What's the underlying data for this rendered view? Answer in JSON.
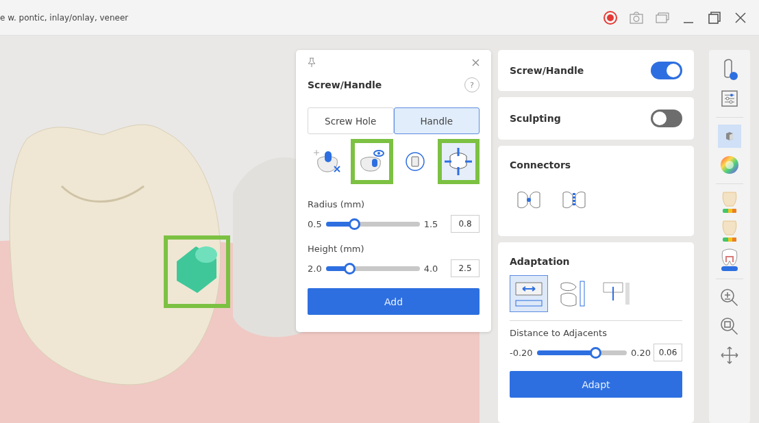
{
  "window": {
    "title": "e w. pontic, inlay/onlay, veneer",
    "recording": true
  },
  "model": {
    "handle_highlighted": true
  },
  "tool_panel": {
    "title": "Screw/Handle",
    "help": "?",
    "tabs": [
      {
        "label": "Screw Hole",
        "selected": false
      },
      {
        "label": "Handle",
        "selected": true
      }
    ],
    "tools": [
      {
        "kind": "auto",
        "selected": false,
        "highlighted": false
      },
      {
        "kind": "view",
        "selected": false,
        "highlighted": true
      },
      {
        "kind": "delete",
        "selected": false,
        "highlighted": false
      },
      {
        "kind": "move",
        "selected": true,
        "highlighted": true
      }
    ],
    "sliders": [
      {
        "label": "Radius (mm)",
        "min": "0.5",
        "max": "1.5",
        "value": "0.8",
        "level": 0.3
      },
      {
        "label": "Height (mm)",
        "min": "2.0",
        "max": "4.0",
        "value": "2.5",
        "level": 0.25
      }
    ],
    "button": "Add"
  },
  "sections": [
    {
      "kind": "toggle",
      "title": "Screw/Handle",
      "on": true
    },
    {
      "kind": "toggle",
      "title": "Sculpting",
      "on": false
    },
    {
      "kind": "tools",
      "title": "Connectors",
      "tools": [
        {
          "kind": "connector-single",
          "selected": false
        },
        {
          "kind": "connector-multi",
          "selected": false
        }
      ]
    },
    {
      "kind": "adaptation",
      "title": "Adaptation",
      "tools": [
        {
          "kind": "adapt-contact",
          "selected": true
        },
        {
          "kind": "adapt-occlusion",
          "selected": false
        },
        {
          "kind": "adapt-height",
          "selected": false
        }
      ],
      "slider": {
        "label": "Distance to Adjacents",
        "min": "-0.20",
        "max": "0.20",
        "value": "0.06",
        "level": 0.65
      },
      "button": "Adapt"
    }
  ],
  "toolbar": {
    "groups": [
      {
        "items": [
          {
            "kind": "tooth-info",
            "selected": false
          },
          {
            "kind": "settings",
            "selected": false
          }
        ]
      },
      {
        "items": [
          {
            "kind": "cube",
            "selected": true
          },
          {
            "kind": "color",
            "selected": false
          }
        ]
      },
      {
        "items": [
          {
            "kind": "tooth-map",
            "selected": false
          },
          {
            "kind": "tooth-map2",
            "selected": false
          },
          {
            "kind": "tooth-on",
            "selected": false
          }
        ]
      },
      {
        "items": [
          {
            "kind": "zoom-in",
            "selected": false
          },
          {
            "kind": "zoom-fit",
            "selected": false
          },
          {
            "kind": "pan",
            "selected": false
          }
        ]
      }
    ]
  }
}
